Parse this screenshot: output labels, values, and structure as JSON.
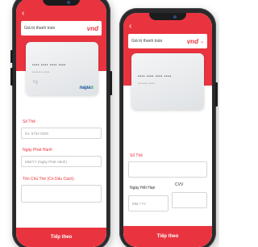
{
  "left_phone": {
    "back_icon": "‹",
    "amount_placeholder": "Giá trị thanh toán",
    "currency": "vnd",
    "card_number_dots": "•••• •••• •••• ••••",
    "card_small_dots": "•••••••• •••••",
    "contactless_icon": "contactless-icon",
    "brand_napa": "napa",
    "brand_s": "s",
    "card_number_label": "Số Thẻ",
    "card_number_placeholder": "Ex: 9704 0000",
    "issue_date_label": "Ngày Phát Hành",
    "issue_date_placeholder": "MM/YY (Ngày Phát Hành)",
    "holder_label": "Tên Chủ Thẻ (Có Dấu Cách)",
    "next_label": "Tiếp theo"
  },
  "right_phone": {
    "back_icon": "‹",
    "amount_placeholder": "Giá trị thanh toán",
    "currency": "vnd",
    "card_number_dots": "•••• •••• •••• ••••",
    "card_small_dots": "•••••••• •••••",
    "card_number_label": "Số Thẻ",
    "card_number_placeholder": "",
    "expiry_label": "Ngày Hết Hạn",
    "expiry_placeholder": "MM / YY",
    "cvv_label": "CVV",
    "next_label": "Tiếp theo"
  },
  "colors": {
    "accent": "#e9343f",
    "phone_frame": "#2a2a2c"
  }
}
